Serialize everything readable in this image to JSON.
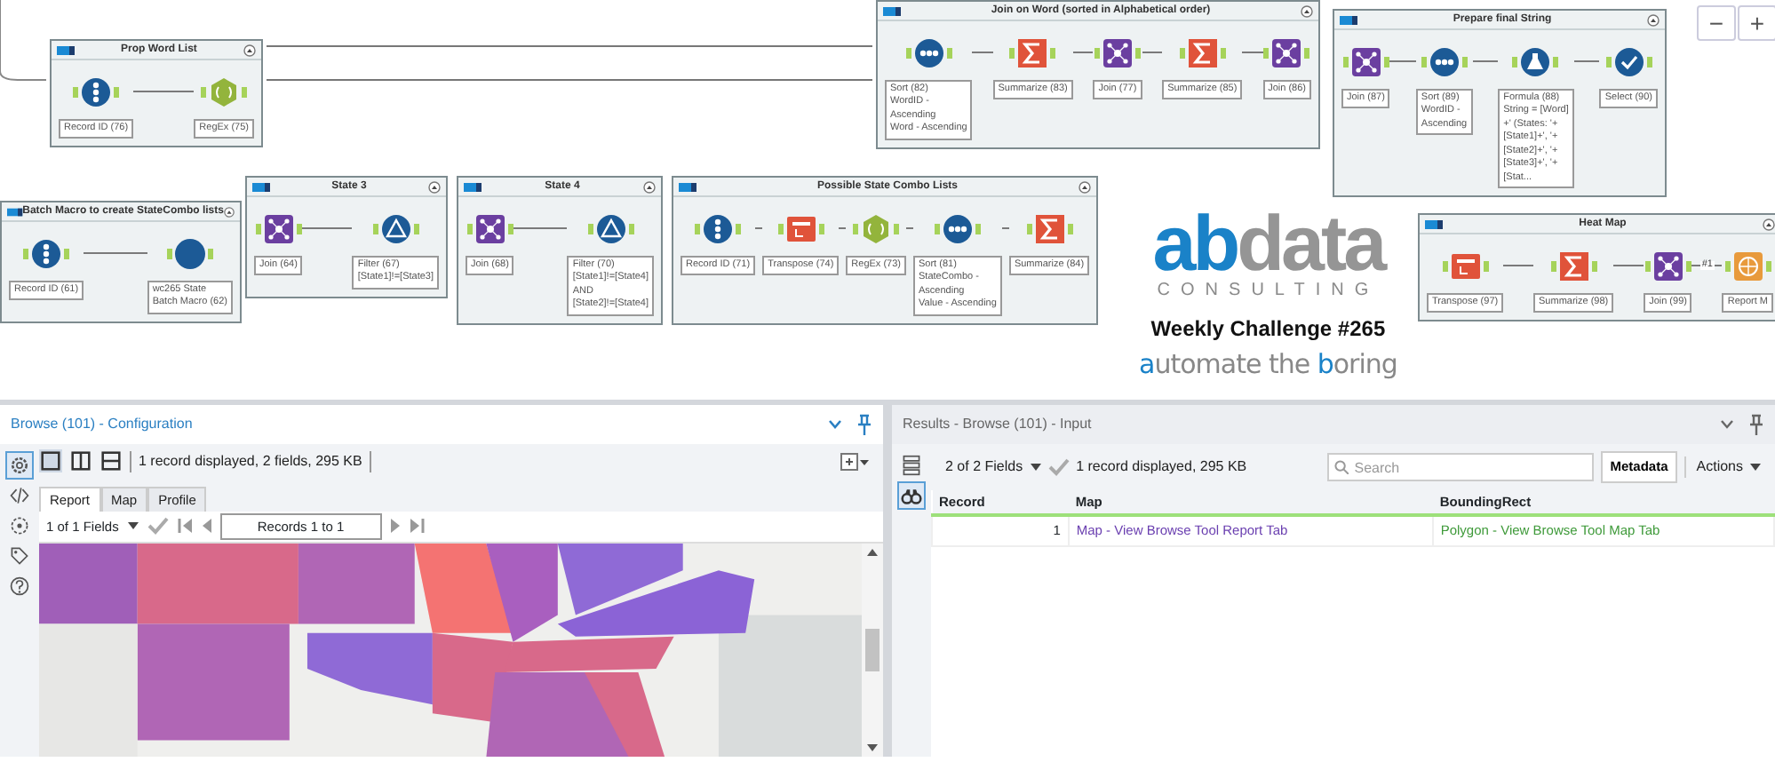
{
  "canvas": {
    "containers": [
      {
        "title": "Prop Word List",
        "tools": [
          {
            "kind": "record_id",
            "label": "Record ID (76)"
          },
          {
            "kind": "regex",
            "label": "RegEx (75)"
          }
        ]
      },
      {
        "title": "Join on Word (sorted in Alphabetical order)",
        "tools": [
          {
            "kind": "sort",
            "label": "Sort (82)\nWordID -\nAscending\nWord - Ascending"
          },
          {
            "kind": "summarize",
            "label": "Summarize (83)"
          },
          {
            "kind": "join",
            "label": "Join (77)"
          },
          {
            "kind": "summarize",
            "label": "Summarize (85)"
          },
          {
            "kind": "join",
            "label": "Join (86)"
          }
        ]
      },
      {
        "title": "Prepare final String",
        "tools": [
          {
            "kind": "join",
            "label": "Join (87)"
          },
          {
            "kind": "sort",
            "label": "Sort (89)\nWordID -\nAscending"
          },
          {
            "kind": "formula",
            "label": "Formula (88)\nString = [Word]\n+' (States: '+\n[State1]+', '+\n[State2]+', '+\n[State3]+', '+\n[Stat..."
          },
          {
            "kind": "select",
            "label": "Select (90)"
          }
        ]
      },
      {
        "title": "Batch Macro to create StateCombo lists",
        "tools": [
          {
            "kind": "record_id",
            "label": "Record ID (61)"
          },
          {
            "kind": "macro",
            "label": "wc265 State\nBatch Macro (62)"
          }
        ]
      },
      {
        "title": "State 3",
        "tools": [
          {
            "kind": "join",
            "label": "Join (64)"
          },
          {
            "kind": "filter",
            "label": "Filter (67)\n[State1]!=[State3]"
          }
        ]
      },
      {
        "title": "State 4",
        "tools": [
          {
            "kind": "join",
            "label": "Join (68)"
          },
          {
            "kind": "filter",
            "label": "Filter (70)\n[State1]!=[State4]\nAND\n[State2]!=[State4]"
          }
        ]
      },
      {
        "title": "Possible State Combo Lists",
        "tools": [
          {
            "kind": "record_id",
            "label": "Record ID (71)"
          },
          {
            "kind": "transpose",
            "label": "Transpose (74)"
          },
          {
            "kind": "regex",
            "label": "RegEx (73)"
          },
          {
            "kind": "sort",
            "label": "Sort (81)\nStateCombo -\nAscending\nValue - Ascending"
          },
          {
            "kind": "summarize",
            "label": "Summarize (84)"
          }
        ]
      },
      {
        "title": "Heat Map",
        "tools": [
          {
            "kind": "transpose",
            "label": "Transpose (97)"
          },
          {
            "kind": "summarize",
            "label": "Summarize (98)"
          },
          {
            "kind": "join",
            "label": "Join (99)"
          },
          {
            "kind": "report",
            "label": "Report M",
            "incoming_label": "#1"
          }
        ]
      }
    ],
    "zoom_buttons": [
      "−",
      "+"
    ],
    "logo": {
      "parts": [
        {
          "text": "ab",
          "accent": true
        },
        {
          "text": "data",
          "accent": false
        }
      ],
      "subtitle": "CONSULTING",
      "challenge": "Weekly Challenge #265",
      "tagline": [
        {
          "text": "a",
          "accent": true
        },
        {
          "text": "utomate the ",
          "accent": false
        },
        {
          "text": "b",
          "accent": true
        },
        {
          "text": "oring",
          "accent": false
        }
      ]
    }
  },
  "config_panel": {
    "title": "Browse (101) - Configuration",
    "rail": [
      {
        "kind": "gear",
        "selected": true
      },
      {
        "kind": "code",
        "selected": false
      },
      {
        "kind": "target",
        "selected": false
      },
      {
        "kind": "tag",
        "selected": false
      },
      {
        "kind": "help",
        "selected": false
      }
    ],
    "view_modes": [
      {
        "kind": "single",
        "selected": true
      },
      {
        "kind": "columns",
        "selected": false
      },
      {
        "kind": "rows",
        "selected": false
      }
    ],
    "summary": "1 record displayed, 2 fields, 295 KB",
    "tabs": [
      {
        "label": "Report",
        "selected": true
      },
      {
        "label": "Map",
        "selected": false
      },
      {
        "label": "Profile",
        "selected": false
      }
    ],
    "field_selector": "1 of 1 Fields",
    "records": "Records 1 to 1"
  },
  "results_panel": {
    "title": "Results - Browse (101) - Input",
    "rail": [
      {
        "kind": "list",
        "selected": false
      },
      {
        "kind": "binoculars",
        "selected": true
      }
    ],
    "field_selector": "2 of 2 Fields",
    "summary": "1 record displayed, 295 KB",
    "search": {
      "placeholder": "Search"
    },
    "metadata_button": "Metadata",
    "actions": "Actions",
    "table": {
      "columns": [
        "Record",
        "Map",
        "BoundingRect"
      ],
      "rows": [
        {
          "cells": [
            {
              "text": "1"
            },
            {
              "text": "Map - View Browse Tool Report Tab",
              "color": "#6a3fb0"
            },
            {
              "text": "Polygon - View Browse Tool Map Tab",
              "color": "#3f9a3a"
            }
          ]
        }
      ]
    }
  }
}
